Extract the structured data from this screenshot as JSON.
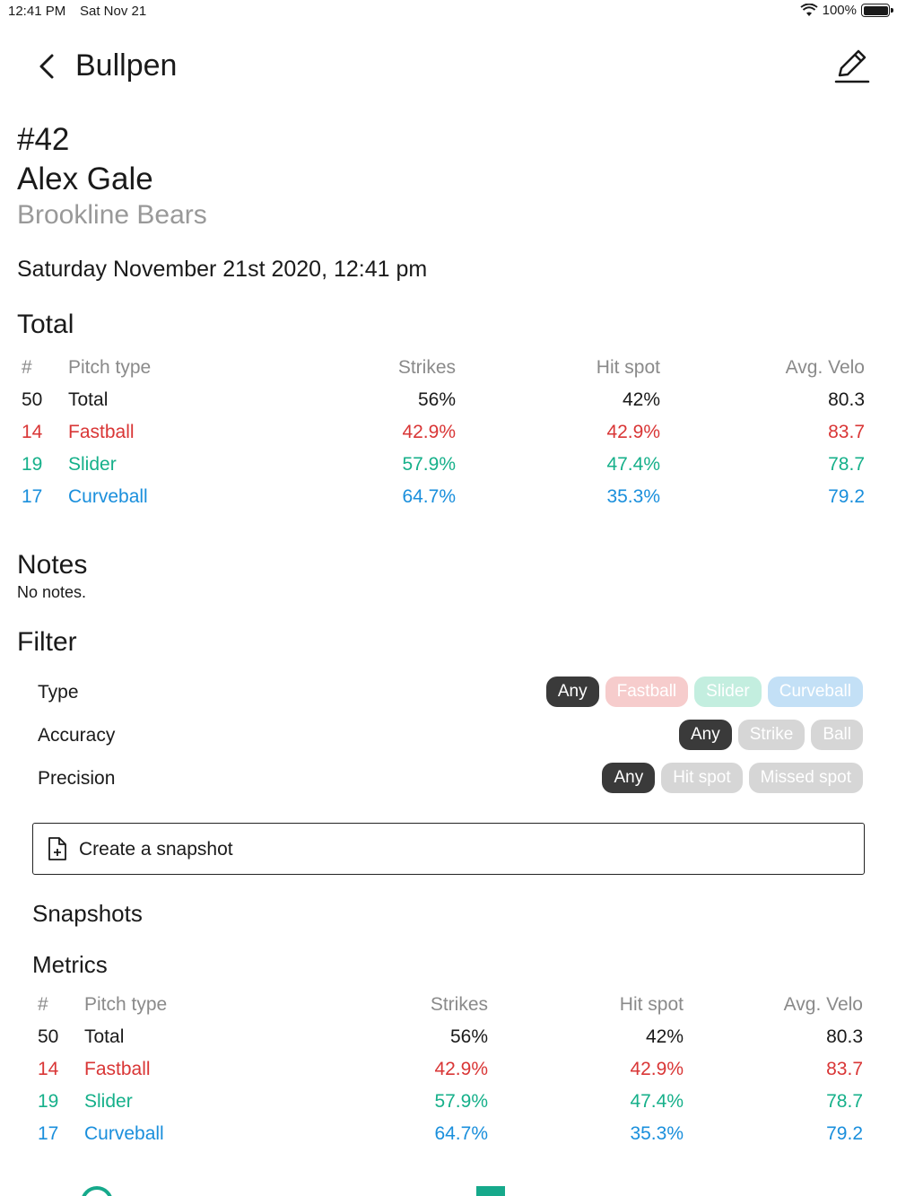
{
  "status_bar": {
    "time": "12:41 PM",
    "date": "Sat Nov 21",
    "battery": "100%",
    "battery_level": 1.0,
    "wifi_icon": "wifi-icon"
  },
  "nav": {
    "title": "Bullpen",
    "back_icon": "chevron-left-icon",
    "edit_icon": "pencil-icon"
  },
  "player": {
    "number": "#42",
    "name": "Alex Gale",
    "team": "Brookline Bears"
  },
  "session_date": "Saturday November 21st 2020, 12:41 pm",
  "colors": {
    "fastball": "#d93636",
    "slider": "#16b08a",
    "curveball": "#1a8fdc",
    "header": "#8a8a8a",
    "chip_active": "#3a3a3a"
  },
  "total": {
    "title": "Total",
    "headers": {
      "num": "#",
      "type": "Pitch type",
      "strikes": "Strikes",
      "hit": "Hit spot",
      "velo": "Avg. Velo"
    },
    "rows": [
      {
        "num": "50",
        "type": "Total",
        "strikes": "56%",
        "hit": "42%",
        "velo": "80.3",
        "color": "#1a1a1a"
      },
      {
        "num": "14",
        "type": "Fastball",
        "strikes": "42.9%",
        "hit": "42.9%",
        "velo": "83.7",
        "color": "#d93636"
      },
      {
        "num": "19",
        "type": "Slider",
        "strikes": "57.9%",
        "hit": "47.4%",
        "velo": "78.7",
        "color": "#16b08a"
      },
      {
        "num": "17",
        "type": "Curveball",
        "strikes": "64.7%",
        "hit": "35.3%",
        "velo": "79.2",
        "color": "#1a8fdc"
      }
    ]
  },
  "notes": {
    "title": "Notes",
    "text": "No notes."
  },
  "filter": {
    "title": "Filter",
    "type": {
      "label": "Type",
      "options": [
        {
          "label": "Any",
          "active": true,
          "bg": "#3a3a3a",
          "fg": "#ffffff"
        },
        {
          "label": "Fastball",
          "active": false,
          "bg": "#f6cccc",
          "fg": "#ffffff"
        },
        {
          "label": "Slider",
          "active": false,
          "bg": "#c3eedf",
          "fg": "#ffffff"
        },
        {
          "label": "Curveball",
          "active": false,
          "bg": "#c3e0f6",
          "fg": "#ffffff"
        }
      ]
    },
    "accuracy": {
      "label": "Accuracy",
      "options": [
        {
          "label": "Any",
          "active": true,
          "bg": "#3a3a3a",
          "fg": "#ffffff"
        },
        {
          "label": "Strike",
          "active": false,
          "bg": "#d6d6d6",
          "fg": "#ffffff"
        },
        {
          "label": "Ball",
          "active": false,
          "bg": "#d6d6d6",
          "fg": "#ffffff"
        }
      ]
    },
    "precision": {
      "label": "Precision",
      "options": [
        {
          "label": "Any",
          "active": true,
          "bg": "#3a3a3a",
          "fg": "#ffffff"
        },
        {
          "label": "Hit spot",
          "active": false,
          "bg": "#d6d6d6",
          "fg": "#ffffff"
        },
        {
          "label": "Missed spot",
          "active": false,
          "bg": "#d6d6d6",
          "fg": "#ffffff"
        }
      ]
    }
  },
  "snapshot_button": {
    "label": "Create a snapshot",
    "icon": "file-plus-icon"
  },
  "snapshots": {
    "title": "Snapshots"
  },
  "metrics": {
    "title": "Metrics",
    "headers": {
      "num": "#",
      "type": "Pitch type",
      "strikes": "Strikes",
      "hit": "Hit spot",
      "velo": "Avg. Velo"
    },
    "rows": [
      {
        "num": "50",
        "type": "Total",
        "strikes": "56%",
        "hit": "42%",
        "velo": "80.3",
        "color": "#1a1a1a"
      },
      {
        "num": "14",
        "type": "Fastball",
        "strikes": "42.9%",
        "hit": "42.9%",
        "velo": "83.7",
        "color": "#d93636"
      },
      {
        "num": "19",
        "type": "Slider",
        "strikes": "57.9%",
        "hit": "47.4%",
        "velo": "78.7",
        "color": "#16b08a"
      },
      {
        "num": "17",
        "type": "Curveball",
        "strikes": "64.7%",
        "hit": "35.3%",
        "velo": "79.2",
        "color": "#1a8fdc"
      }
    ]
  }
}
